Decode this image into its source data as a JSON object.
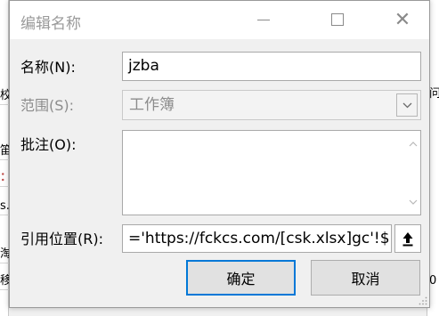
{
  "window": {
    "title": "编辑名称",
    "close_glyph": "✕"
  },
  "form": {
    "name_label": "名称(N):",
    "name_value": "jzba",
    "scope_label": "范围(S):",
    "scope_value": "工作簿",
    "comment_label": "批注(O):",
    "comment_value": "",
    "ref_label": "引用位置(R):",
    "ref_value": "='https://fckcs.com/[csk.xlsx]gc'!$I"
  },
  "buttons": {
    "ok_label": "确定",
    "cancel_label": "取消"
  },
  "background": {
    "left_cells": [
      "",
      "",
      "",
      "",
      "校",
      "",
      "笛",
      "：",
      "",
      "s.",
      "",
      "淘",
      "",
      "移"
    ],
    "right_cells": [
      "",
      "",
      "",
      "",
      "问",
      "",
      "",
      "",
      "",
      "",
      "",
      "",
      "",
      "0"
    ]
  },
  "colors": {
    "accent": "#0078d7",
    "disabled_text": "#8c8c8c",
    "title_text": "#9a9a9a"
  },
  "icons": {
    "minimize": "minimize-icon",
    "maximize": "maximize-icon",
    "close": "close-icon",
    "dropdown": "chevron-down-icon",
    "scroll_up": "chevron-up-icon",
    "scroll_down": "chevron-down-icon",
    "collapse": "collapse-dialog-icon"
  }
}
